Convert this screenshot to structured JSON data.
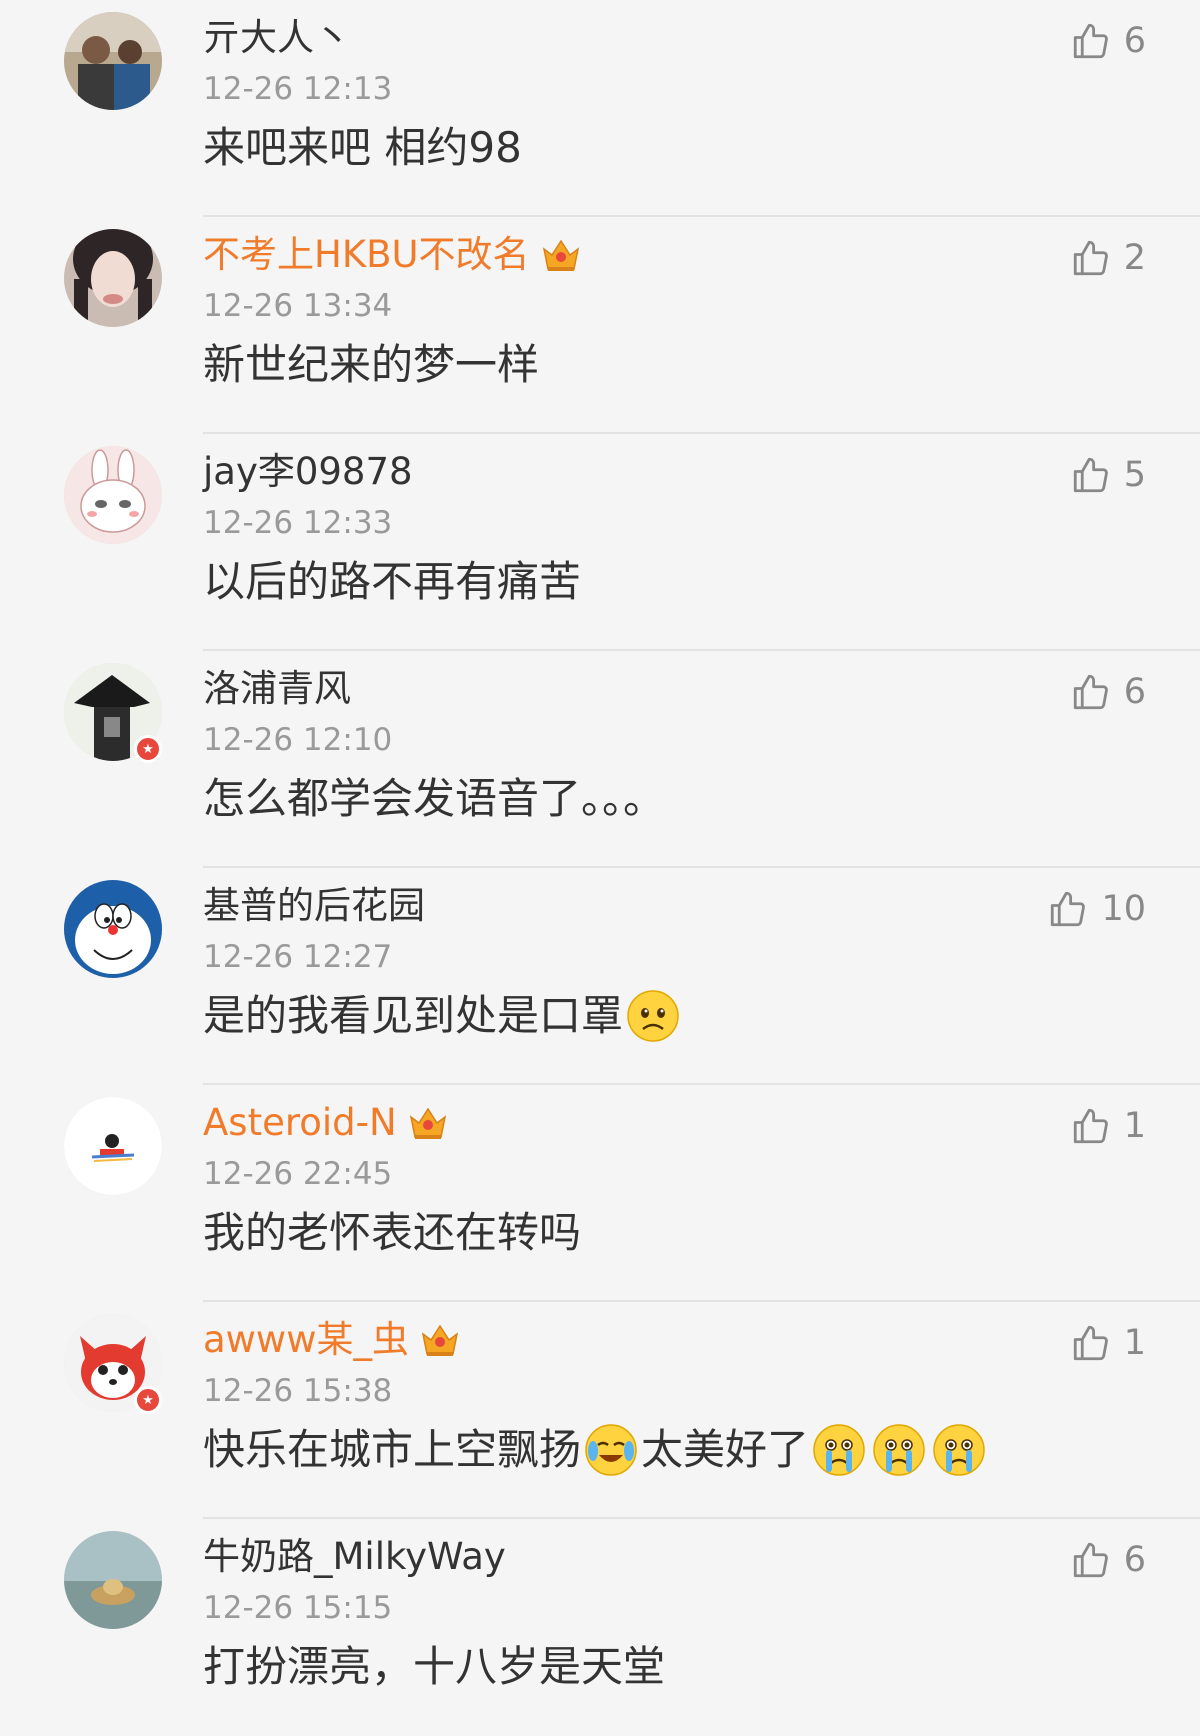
{
  "comments": [
    {
      "username": "亓大人丶",
      "vip": false,
      "timestamp": "12-26 12:13",
      "text": "来吧来吧 相约98",
      "likes": "6",
      "avatar_icon": "avatar-couple-photo",
      "avatar_colors": [
        "#5a4a3a",
        "#c9b9a5"
      ]
    },
    {
      "username": "不考上HKBU不改名",
      "vip": true,
      "timestamp": "12-26 13:34",
      "text": "新世纪来的梦一样",
      "likes": "2",
      "avatar_icon": "avatar-girl-photo",
      "avatar_colors": [
        "#3b3030",
        "#e6d2c8"
      ]
    },
    {
      "username": "jay李09878",
      "vip": false,
      "timestamp": "12-26 12:33",
      "text": "以后的路不再有痛苦",
      "likes": "5",
      "avatar_icon": "avatar-rabbit-cartoon",
      "avatar_colors": [
        "#f7e6e6",
        "#ffffff"
      ]
    },
    {
      "username": "洛浦青风",
      "vip": false,
      "timestamp": "12-26 12:10",
      "text": "怎么都学会发语音了。。。",
      "likes": "6",
      "avatar_icon": "avatar-tower-photo",
      "avatar_colors": [
        "#222222",
        "#eef0ea"
      ]
    },
    {
      "username": "基普的后花园",
      "vip": false,
      "timestamp": "12-26 12:27",
      "text": "是的我看见到处是口罩",
      "likes": "10",
      "avatar_icon": "avatar-doraemon",
      "avatar_colors": [
        "#1d5fa8",
        "#ffffff"
      ]
    },
    {
      "username": "Asteroid-N",
      "vip": true,
      "timestamp": "12-26 22:45",
      "text": "我的老怀表还在转吗",
      "likes": "1",
      "avatar_icon": "avatar-small-drawing",
      "avatar_colors": [
        "#ffffff",
        "#333333"
      ]
    },
    {
      "username": "awww某_虫",
      "vip": true,
      "timestamp": "12-26 15:38",
      "text": "快乐在城市上空飘扬",
      "text2": "太美好了",
      "likes": "1",
      "avatar_icon": "avatar-red-fox-cartoon",
      "avatar_colors": [
        "#e33b2f",
        "#ffffff"
      ]
    },
    {
      "username": "牛奶路_MilkyWay",
      "vip": false,
      "timestamp": "12-26 15:15",
      "text": "打扮漂亮，十八岁是天堂",
      "likes": "6",
      "avatar_icon": "avatar-seaside-photo",
      "avatar_colors": [
        "#8fa7a8",
        "#c8a060"
      ]
    }
  ],
  "colors": {
    "vip_name": "#f07c2b",
    "normal_name": "#333333",
    "timestamp": "#9a9a9a",
    "like": "#888888",
    "background": "#f5f5f5"
  }
}
